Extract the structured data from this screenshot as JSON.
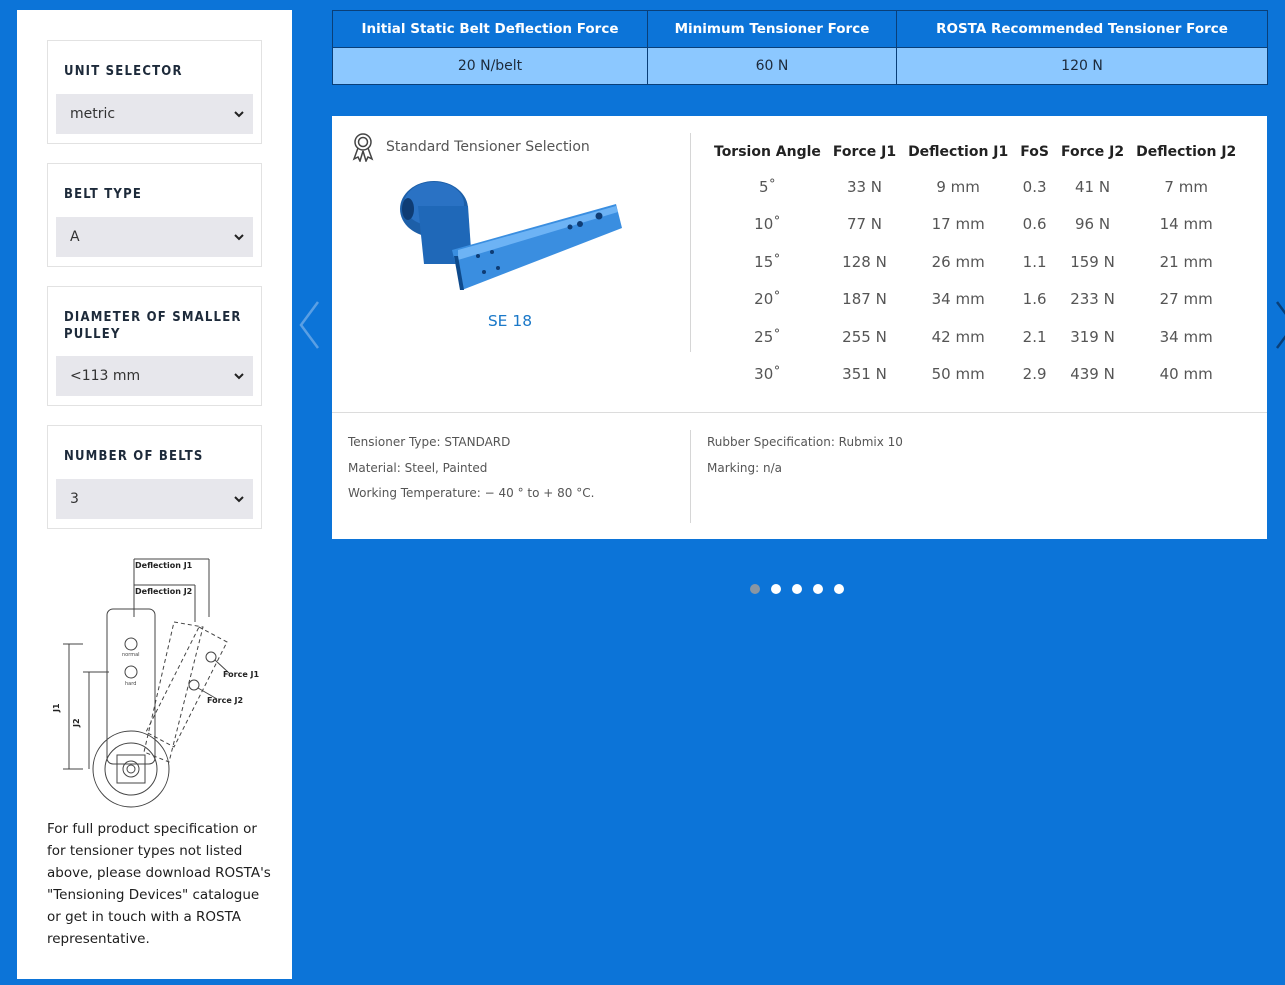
{
  "filters": {
    "unit": {
      "title": "Unit Selector",
      "value": "metric"
    },
    "belt_type": {
      "title": "Belt Type",
      "value": "A"
    },
    "diameter": {
      "title": "Diameter of Smaller Pulley",
      "value": "<113 mm"
    },
    "belts": {
      "title": "Number of Belts",
      "value": "3"
    }
  },
  "diagram": {
    "deflection_j1": "Deflection J1",
    "deflection_j2": "Deflection J2",
    "force_j1": "Force J1",
    "force_j2": "Force J2",
    "j1": "J1",
    "j2": "J2",
    "normal": "normal",
    "hard": "hard"
  },
  "side_note": "For full product specification or for tensioner types not listed above, please download ROSTA's \"Tensioning Devices\" catalogue or get in touch with a ROSTA representative.",
  "summary": {
    "headers": [
      "Initial Static Belt Deflection Force",
      "Minimum Tensioner Force",
      "ROSTA Recommended Tensioner Force"
    ],
    "values": [
      "20 N/belt",
      "60 N",
      "120 N"
    ]
  },
  "card": {
    "heading": "Standard Tensioner Selection",
    "product_name": "SE 18",
    "spec_headers": [
      "Torsion Angle",
      "Force J1",
      "Deflection J1",
      "FoS",
      "Force J2",
      "Deflection J2"
    ],
    "rows": [
      [
        "5˚",
        "33 N",
        "9 mm",
        "0.3",
        "41 N",
        "7 mm"
      ],
      [
        "10˚",
        "77 N",
        "17 mm",
        "0.6",
        "96 N",
        "14 mm"
      ],
      [
        "15˚",
        "128 N",
        "26 mm",
        "1.1",
        "159 N",
        "21 mm"
      ],
      [
        "20˚",
        "187 N",
        "34 mm",
        "1.6",
        "233 N",
        "27 mm"
      ],
      [
        "25˚",
        "255 N",
        "42 mm",
        "2.1",
        "319 N",
        "34 mm"
      ],
      [
        "30˚",
        "351 N",
        "50 mm",
        "2.9",
        "439 N",
        "40 mm"
      ]
    ],
    "info_left": [
      "Tensioner Type: STANDARD",
      "Material: Steel, Painted",
      "Working Temperature: − 40 ° to + 80 °C."
    ],
    "info_right": [
      "Rubber Specification: Rubmix 10",
      "Marking: n/a"
    ]
  },
  "carousel": {
    "slides": 5,
    "active_index": 0
  },
  "colors": {
    "background": "#0c74d8",
    "header": "#0c74d8",
    "value_cell": "#8cc8ff",
    "link": "#1a78c8"
  }
}
